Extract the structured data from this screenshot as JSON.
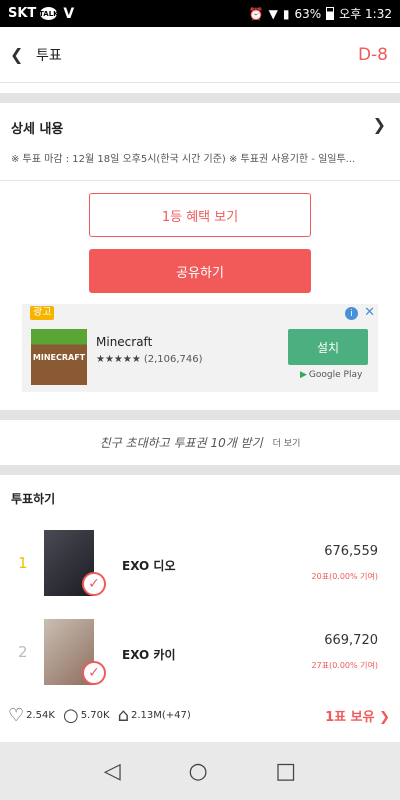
{
  "status_bar": {
    "carrier": "SKT",
    "talk_badge": "TALK",
    "v_logo": "V",
    "battery": "63%",
    "time": "오후 1:32"
  },
  "header": {
    "title": "투표",
    "dday": "D-8"
  },
  "details": {
    "title": "상세 내용",
    "text": "※ 투표 마감 : 12월 18일 오후5시(한국 시간 기준) ※ 투표권 사용기한 - 일일투..."
  },
  "buttons": {
    "benefit": "1등 혜택 보기",
    "share": "공유하기"
  },
  "ad": {
    "badge": "광고",
    "app_name": "Minecraft",
    "icon_text": "MINECRAFT",
    "stars": "★★★★★",
    "rating_count": "(2,106,746)",
    "install": "설치",
    "store": "Google Play"
  },
  "invite": {
    "text": "친구 초대하고 투표권 10개 받기",
    "more": "더 보기"
  },
  "vote": {
    "title": "투표하기",
    "candidates": [
      {
        "rank": "1",
        "name": "EXO 디오",
        "count": "676,559",
        "contribution": "20표(0.00% 기여)",
        "rank_color": "#f5c000"
      },
      {
        "rank": "2",
        "name": "EXO 카이",
        "count": "669,720",
        "contribution": "27표(0.00% 기여)",
        "rank_color": "#bbbbbb"
      }
    ]
  },
  "stats": {
    "likes": "2.54K",
    "comments": "5.70K",
    "votes": "2.13M(+47)",
    "owned": "1표 보유"
  }
}
